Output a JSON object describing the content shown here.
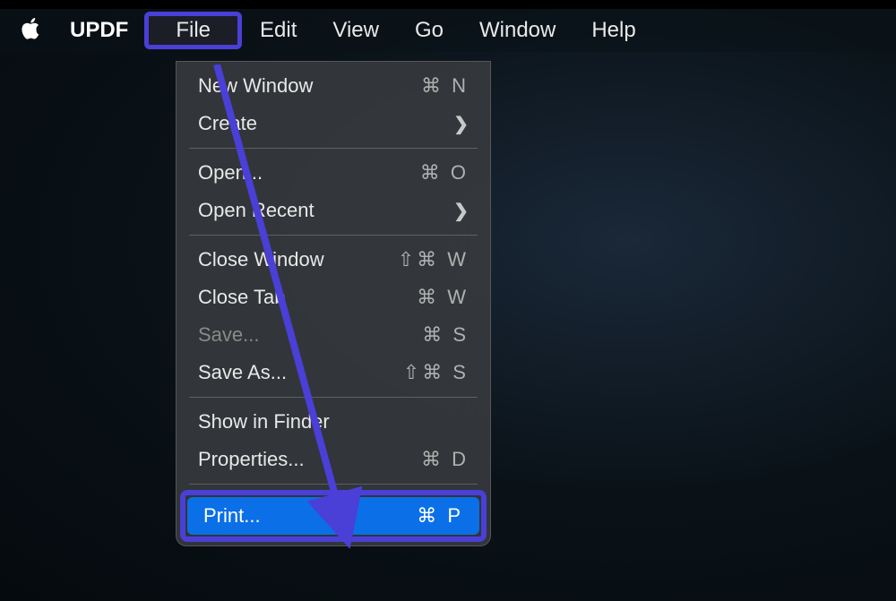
{
  "menubar": {
    "app_name": "UPDF",
    "items": [
      {
        "label": "File",
        "active": true
      },
      {
        "label": "Edit"
      },
      {
        "label": "View"
      },
      {
        "label": "Go"
      },
      {
        "label": "Window"
      },
      {
        "label": "Help"
      }
    ]
  },
  "file_menu": {
    "groups": [
      [
        {
          "label": "New Window",
          "shortcut": "⌘ N"
        },
        {
          "label": "Create",
          "submenu": true
        }
      ],
      [
        {
          "label": "Open...",
          "shortcut": "⌘ O"
        },
        {
          "label": "Open Recent",
          "submenu": true
        }
      ],
      [
        {
          "label": "Close Window",
          "shortcut": "⇧⌘ W"
        },
        {
          "label": "Close Tab",
          "shortcut": "⌘ W"
        },
        {
          "label": "Save...",
          "shortcut": "⌘ S",
          "disabled": true
        },
        {
          "label": "Save As...",
          "shortcut": "⇧⌘ S"
        }
      ],
      [
        {
          "label": "Show in Finder"
        },
        {
          "label": "Properties...",
          "shortcut": "⌘ D"
        }
      ],
      [
        {
          "label": "Print...",
          "shortcut": "⌘ P",
          "selected": true,
          "highlighted": true
        }
      ]
    ]
  },
  "annotation": {
    "arrow_color": "#4a3fd6"
  }
}
